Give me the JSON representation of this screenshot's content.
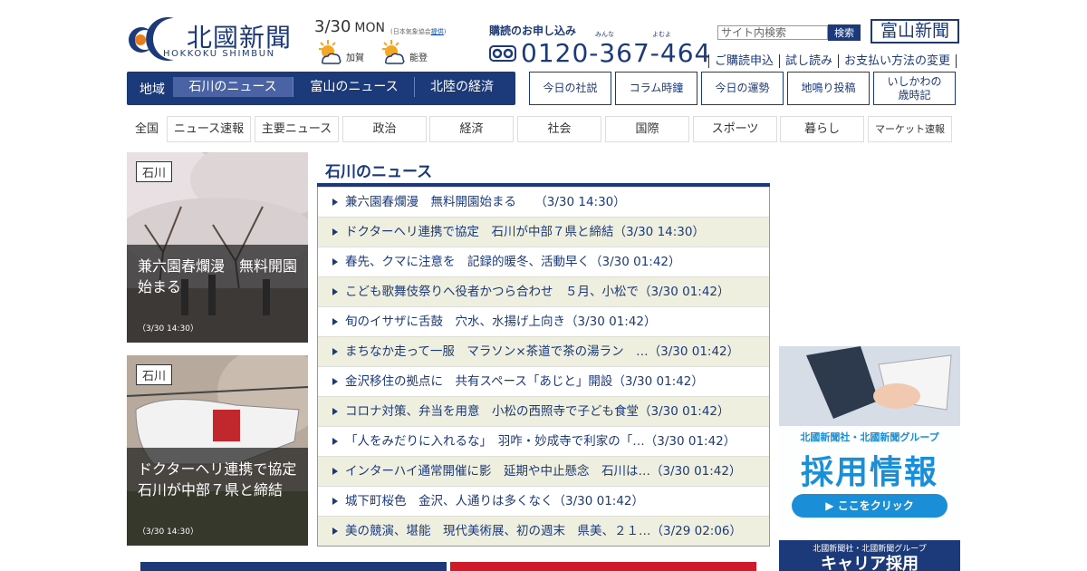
{
  "logo": {
    "name": "北國新聞",
    "sub": "HOKKOKU SHIMBUN"
  },
  "date": {
    "day": "3/30",
    "weekday": "MON"
  },
  "weather": {
    "source_prefix": "(日本気象協会",
    "source_link": "提供",
    "source_suffix": ")",
    "areas": [
      {
        "label": "加賀",
        "icon": "sunny-cloudy-icon"
      },
      {
        "label": "能登",
        "icon": "sunny-cloudy-icon"
      }
    ]
  },
  "subscribe": {
    "title": "購読のお申し込み",
    "ruby_minna": "みんな",
    "ruby_yomu": "よむよ",
    "phone": "0120-367-464"
  },
  "search": {
    "placeholder": "サイト内検索",
    "value": "",
    "button": "検索"
  },
  "toyama_logo": "富山新聞",
  "sub_links": [
    "ご購読申込",
    "試し読み",
    "お支払い方法の変更"
  ],
  "region": {
    "label": "地域",
    "tabs": [
      "石川のニュース",
      "富山のニュース",
      "北陸の経済"
    ],
    "active_index": 0
  },
  "feature_buttons": [
    "今日の社説",
    "コラム時鐘",
    "今日の運勢",
    "地鳴り投稿",
    "いしかわの\n歳時記"
  ],
  "categories": {
    "first": "全国",
    "items": [
      "ニュース速報",
      "主要ニュース",
      "政治",
      "経済",
      "社会",
      "国際",
      "スポーツ",
      "暮らし",
      "マーケット速報"
    ]
  },
  "photos": [
    {
      "tag": "石川",
      "caption": "兼六園春爛漫　無料開園始まる",
      "time": "（3/30 14:30）"
    },
    {
      "tag": "石川",
      "caption": "ドクターヘリ連携で協定　石川が中部７県と締結",
      "time": "（3/30 14:30）"
    }
  ],
  "news": {
    "title": "石川のニュース",
    "items": [
      "兼六園春爛漫　無料開園始まる　　（3/30 14:30）",
      "ドクターヘリ連携で協定　石川が中部７県と締結（3/30 14:30）",
      "春先、クマに注意を　記録的暖冬、活動早く（3/30 01:42）",
      "こども歌舞伎祭りへ役者かつら合わせ　５月、小松で（3/30 01:42）",
      "旬のイサザに舌鼓　穴水、水揚げ上向き（3/30 01:42）",
      "まちなか走って一服　マラソン×茶道で茶の湯ラン　…（3/30 01:42）",
      "金沢移住の拠点に　共有スペース「あじと」開設（3/30 01:42）",
      "コロナ対策、弁当を用意　小松の西照寺で子ども食堂（3/30 01:42）",
      "「人をみだりに入れるな」　羽咋・妙成寺で利家の「…（3/30 01:42）",
      "インターハイ通常開催に影　延期や中止懸念　石川は…（3/30 01:42）",
      "城下町桜色　金沢、人通りは多くなく（3/30 01:42）",
      "美の競演、堪能　現代美術展、初の週末　県美、２１…（3/29 02:06）"
    ]
  },
  "ads": {
    "recruit_company": "北國新聞社・北國新聞グループ",
    "recruit_title": "採用情報",
    "recruit_button": "▶ ここをクリック",
    "career_company": "北國新聞社・北國新聞グループ",
    "career_title": "キャリア採用"
  },
  "colors": {
    "brand_navy": "#1c3a7a",
    "active_tab": "#4a63a5",
    "row_alt": "#efefdf",
    "ad_blue": "#1a8ed6"
  }
}
